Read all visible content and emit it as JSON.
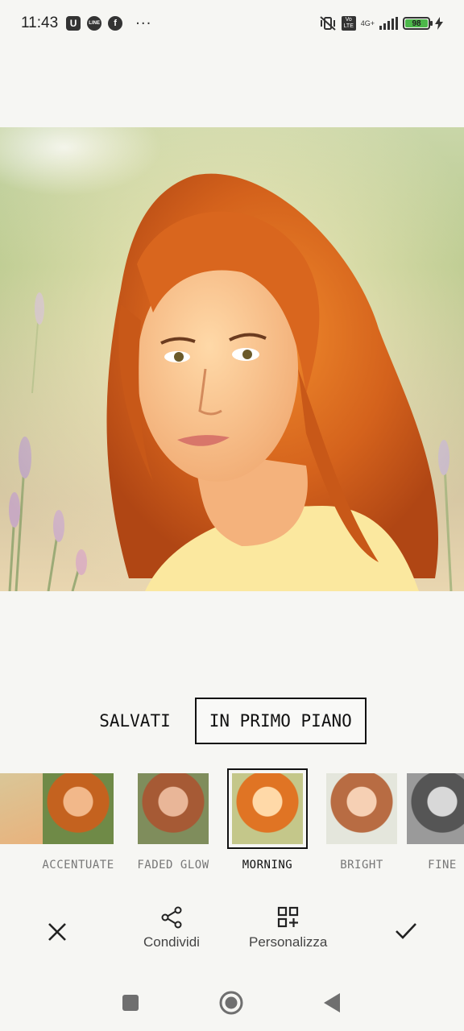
{
  "status_bar": {
    "time": "11:43",
    "app_icons": [
      "U",
      "LINE",
      "f"
    ],
    "overflow": "···",
    "volte": "Vo LTE",
    "network": "4G+",
    "battery": "98",
    "battery_color": "#4cb84a"
  },
  "tabs": [
    {
      "label": "SALVATI",
      "active": false
    },
    {
      "label": "IN PRIMO PIANO",
      "active": true
    }
  ],
  "filters": [
    {
      "label": "",
      "tint": "warm"
    },
    {
      "label": "ACCENTUATE",
      "tint": "vivid"
    },
    {
      "label": "FADED GLOW",
      "tint": "faded"
    },
    {
      "label": "MORNING",
      "tint": "morning",
      "selected": true
    },
    {
      "label": "BRIGHT",
      "tint": "bright"
    },
    {
      "label": "FINE",
      "tint": "mono"
    }
  ],
  "actions": {
    "close_icon": "close-icon",
    "share_label": "Condividi",
    "customize_label": "Personalizza",
    "confirm_icon": "check-icon"
  },
  "navbar": {
    "icons": [
      "square-icon",
      "circle-home-icon",
      "triangle-back-icon"
    ]
  },
  "colors": {
    "background": "#f6f6f3",
    "text": "#111111",
    "muted": "#777777",
    "hair": "#d2691e"
  }
}
